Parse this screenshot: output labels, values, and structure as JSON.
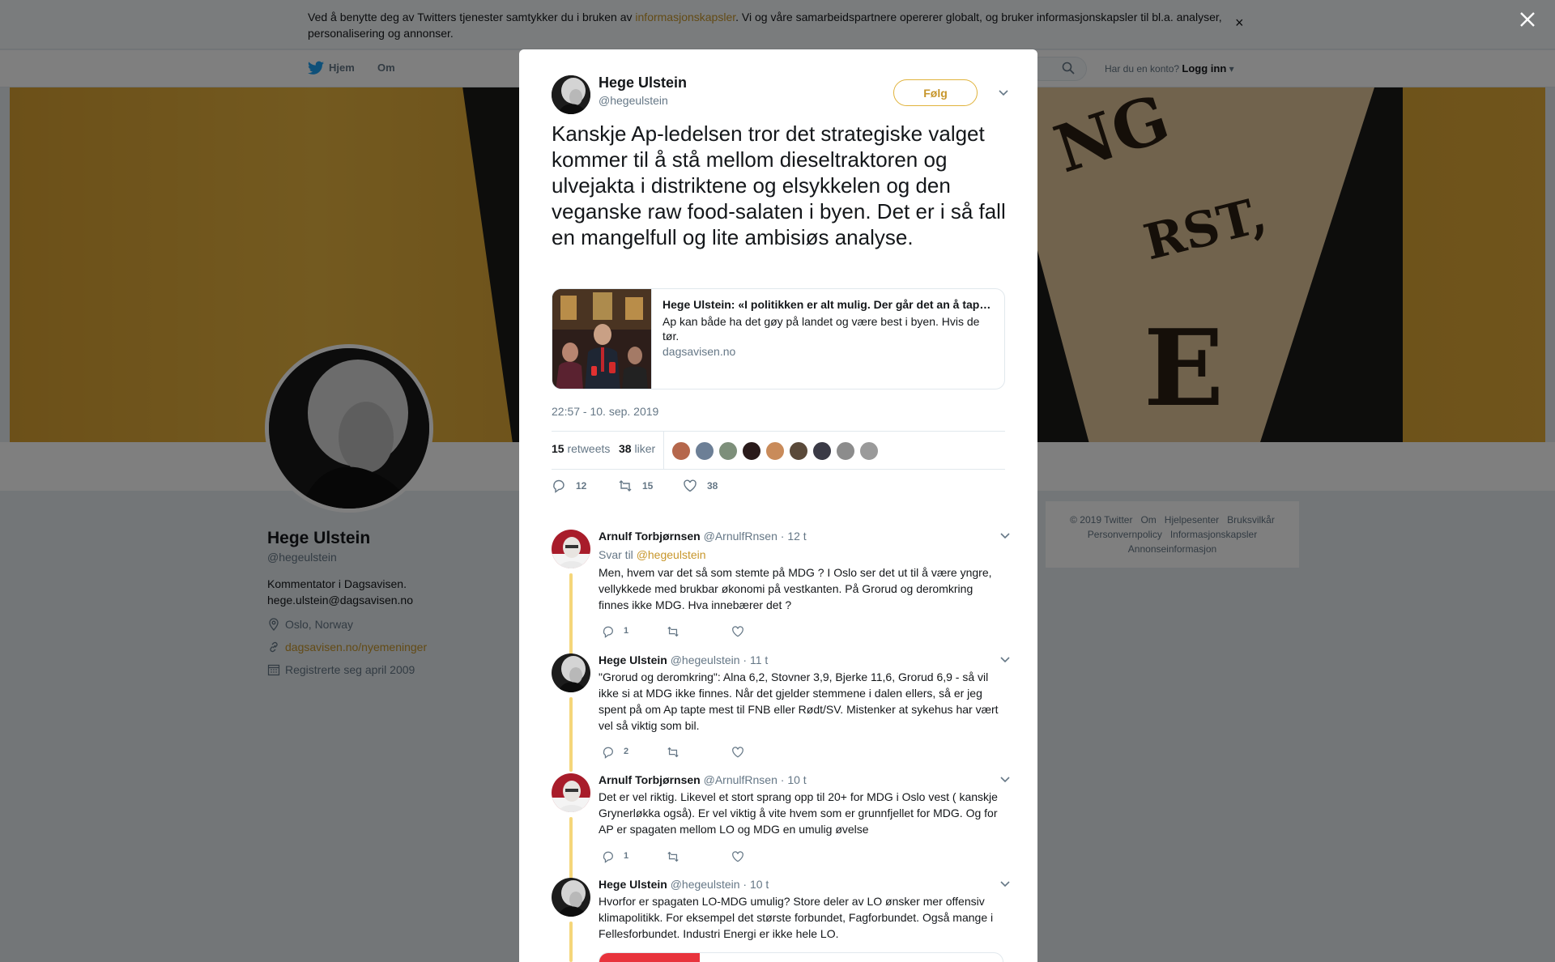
{
  "cookie_bar": {
    "text_before": "Ved å benytte deg av Twitters tjenester samtykker du i bruken av ",
    "link": "informasjonskapsler",
    "text_after": ". Vi og våre samarbeidspartnere opererer globalt, og bruker informasjonskapsler til bl.a. analyser, personalisering og annonser.",
    "close": "×"
  },
  "nav": {
    "home": "Hjem",
    "about": "Om",
    "account_prompt": "Har du en konto?",
    "login": "Logg inn"
  },
  "profile": {
    "name": "Hege Ulstein",
    "handle": "@hegeulstein",
    "bio_line1": "Kommentator i Dagsavisen.",
    "bio_line2": "hege.ulstein@dagsavisen.no",
    "location": "Oslo, Norway",
    "website": "dagsavisen.no/nyemeninger",
    "joined": "Registrerte seg april 2009"
  },
  "footer": {
    "links_row1": [
      "© 2019 Twitter",
      "Om",
      "Hjelpesenter",
      "Bruksvilkår"
    ],
    "links_row2": [
      "Personvernpolicy",
      "Informasjonskapsler"
    ],
    "links_row3": [
      "Annonseinformasjon"
    ]
  },
  "tweet": {
    "author_name": "Hege Ulstein",
    "author_handle": "@hegeulstein",
    "follow_label": "Følg",
    "text": "Kanskje Ap-ledelsen tror det strategiske valget kommer til å stå mellom dieseltraktoren og ulvejakta i distriktene og elsykkelen og den veganske raw food-salaten i byen. Det er i så fall en mangelfull og lite ambisiøs analyse.",
    "card": {
      "title": "Hege Ulstein: «I politikken er alt mulig. Der går det an å tape…",
      "description": "Ap kan både ha det gøy på landet og være best i byen. Hvis de tør.",
      "domain": "dagsavisen.no"
    },
    "timestamp": "22:57 - 10. sep. 2019",
    "retweets_count": "15",
    "retweets_label": "retweets",
    "likes_count": "38",
    "likes_label": "liker",
    "replies_action": "12",
    "retweets_action": "15",
    "likes_action": "38",
    "liker_colors": [
      "#b5674c",
      "#6c7f96",
      "#7d8f7a",
      "#2a1b1b",
      "#c98b5a",
      "#5a4a3a",
      "#3a3a46",
      "#8c8c8c",
      "#9a9a9a"
    ]
  },
  "replies": [
    {
      "name": "Arnulf Torbjørnsen",
      "handle": "@ArnulfRnsen",
      "time": "· 12 t",
      "reply_to_prefix": "Svar til ",
      "reply_to": "@hegeulstein",
      "text": "Men, hvem var det så som stemte på MDG ? I Oslo ser det ut til å være yngre, vellykkede med brukbar økonomi på vestkanten. På Grorud og deromkring finnes ikke MDG. Hva innebærer det ?",
      "reply_count": "1"
    },
    {
      "name": "Hege Ulstein",
      "handle": "@hegeulstein",
      "time": "· 11 t",
      "text": "\"Grorud og deromkring\": Alna 6,2, Stovner 3,9, Bjerke 11,6, Grorud 6,9 - så vil ikke si at MDG ikke finnes. Når det gjelder stemmene i dalen ellers, så er jeg spent på om Ap tapte mest til FNB eller Rødt/SV. Mistenker at sykehus har vært vel så viktig som bil.",
      "reply_count": "2"
    },
    {
      "name": "Arnulf Torbjørnsen",
      "handle": "@ArnulfRnsen",
      "time": "· 10 t",
      "text": "Det er vel riktig. Likevel et stort sprang opp til 20+ for MDG i Oslo vest ( kanskje Grynerløkka også). Er vel viktig å vite hvem som er grunnfjellet for MDG. Og for AP er spagaten mellom LO og MDG en umulig øvelse",
      "reply_count": "1"
    },
    {
      "name": "Hege Ulstein",
      "handle": "@hegeulstein",
      "time": "· 10 t",
      "text": "Hvorfor er spagaten LO-MDG umulig? Store deler av LO ønsker mer offensiv klimapolitikk. For eksempel det største forbundet, Fagforbundet. Også mange i Fellesforbundet. Industri Energi er ikke hele LO."
    }
  ],
  "colors": {
    "accent": "#c7962b",
    "thread_line": "#f5d67a",
    "text_primary": "#14171a",
    "text_secondary": "#657786"
  }
}
